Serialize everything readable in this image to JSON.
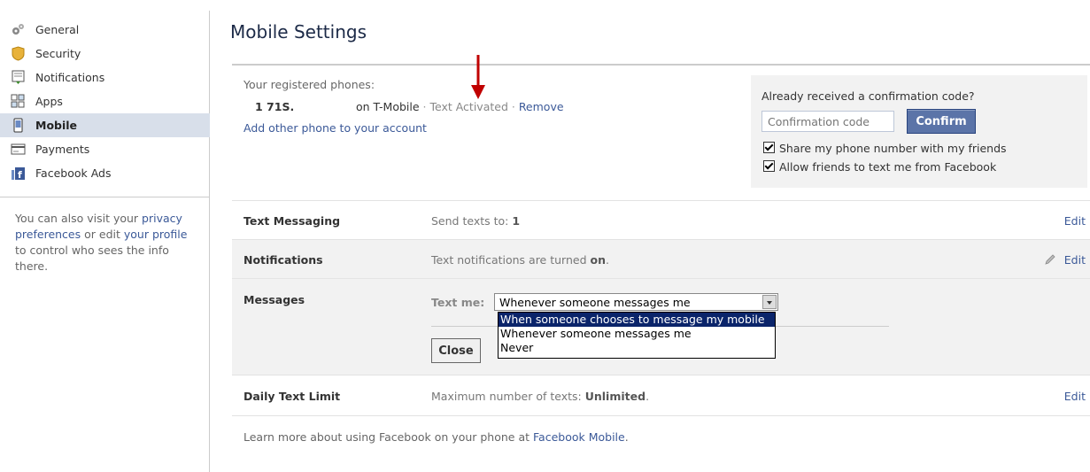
{
  "sidebar": {
    "items": [
      {
        "label": "General",
        "icon": "gear-icon"
      },
      {
        "label": "Security",
        "icon": "shield-icon"
      },
      {
        "label": "Notifications",
        "icon": "notifications-icon"
      },
      {
        "label": "Apps",
        "icon": "apps-icon"
      },
      {
        "label": "Mobile",
        "icon": "mobile-phone-icon",
        "active": true
      },
      {
        "label": "Payments",
        "icon": "credit-card-icon"
      },
      {
        "label": "Facebook Ads",
        "icon": "facebook-ads-icon"
      }
    ],
    "note": {
      "prefix": "You can also visit your ",
      "link1": "privacy preferences",
      "middle": " or edit ",
      "link2": "your profile",
      "suffix": " to control who sees the info there."
    }
  },
  "main": {
    "title": "Mobile Settings",
    "phones": {
      "label": "Your registered phones:",
      "number": "1 71S.",
      "carrier": "on T-Mobile",
      "status": "Text Activated",
      "remove": "Remove",
      "add_link": "Add other phone to your account"
    },
    "confirm": {
      "question": "Already received a confirmation code?",
      "placeholder": "Confirmation code",
      "button": "Confirm",
      "share_label": "Share my phone number with my friends",
      "allow_label": "Allow friends to text me from Facebook"
    },
    "rows": {
      "text_messaging": {
        "label": "Text Messaging",
        "desc_prefix": "Send texts to: ",
        "desc_value": "1",
        "edit": "Edit"
      },
      "notifications": {
        "label": "Notifications",
        "desc_prefix": "Text notifications are turned ",
        "desc_value": "on",
        "desc_suffix": ".",
        "edit": "Edit"
      },
      "messages": {
        "label": "Messages",
        "text_me": "Text me:",
        "selected": "Whenever someone messages me",
        "options": [
          "When someone chooses to message my mobile",
          "Whenever someone messages me",
          "Never"
        ],
        "close": "Close"
      },
      "daily_limit": {
        "label": "Daily Text Limit",
        "desc_prefix": "Maximum number of texts: ",
        "desc_value": "Unlimited",
        "desc_suffix": ".",
        "edit": "Edit"
      }
    },
    "learn_more": {
      "prefix": "Learn more about using Facebook on your phone at ",
      "link": "Facebook Mobile",
      "suffix": "."
    }
  },
  "colors": {
    "link": "#3b5998",
    "active_nav": "#d8dfea",
    "confirm_button": "#5b74a8",
    "arrow": "#c00000"
  }
}
